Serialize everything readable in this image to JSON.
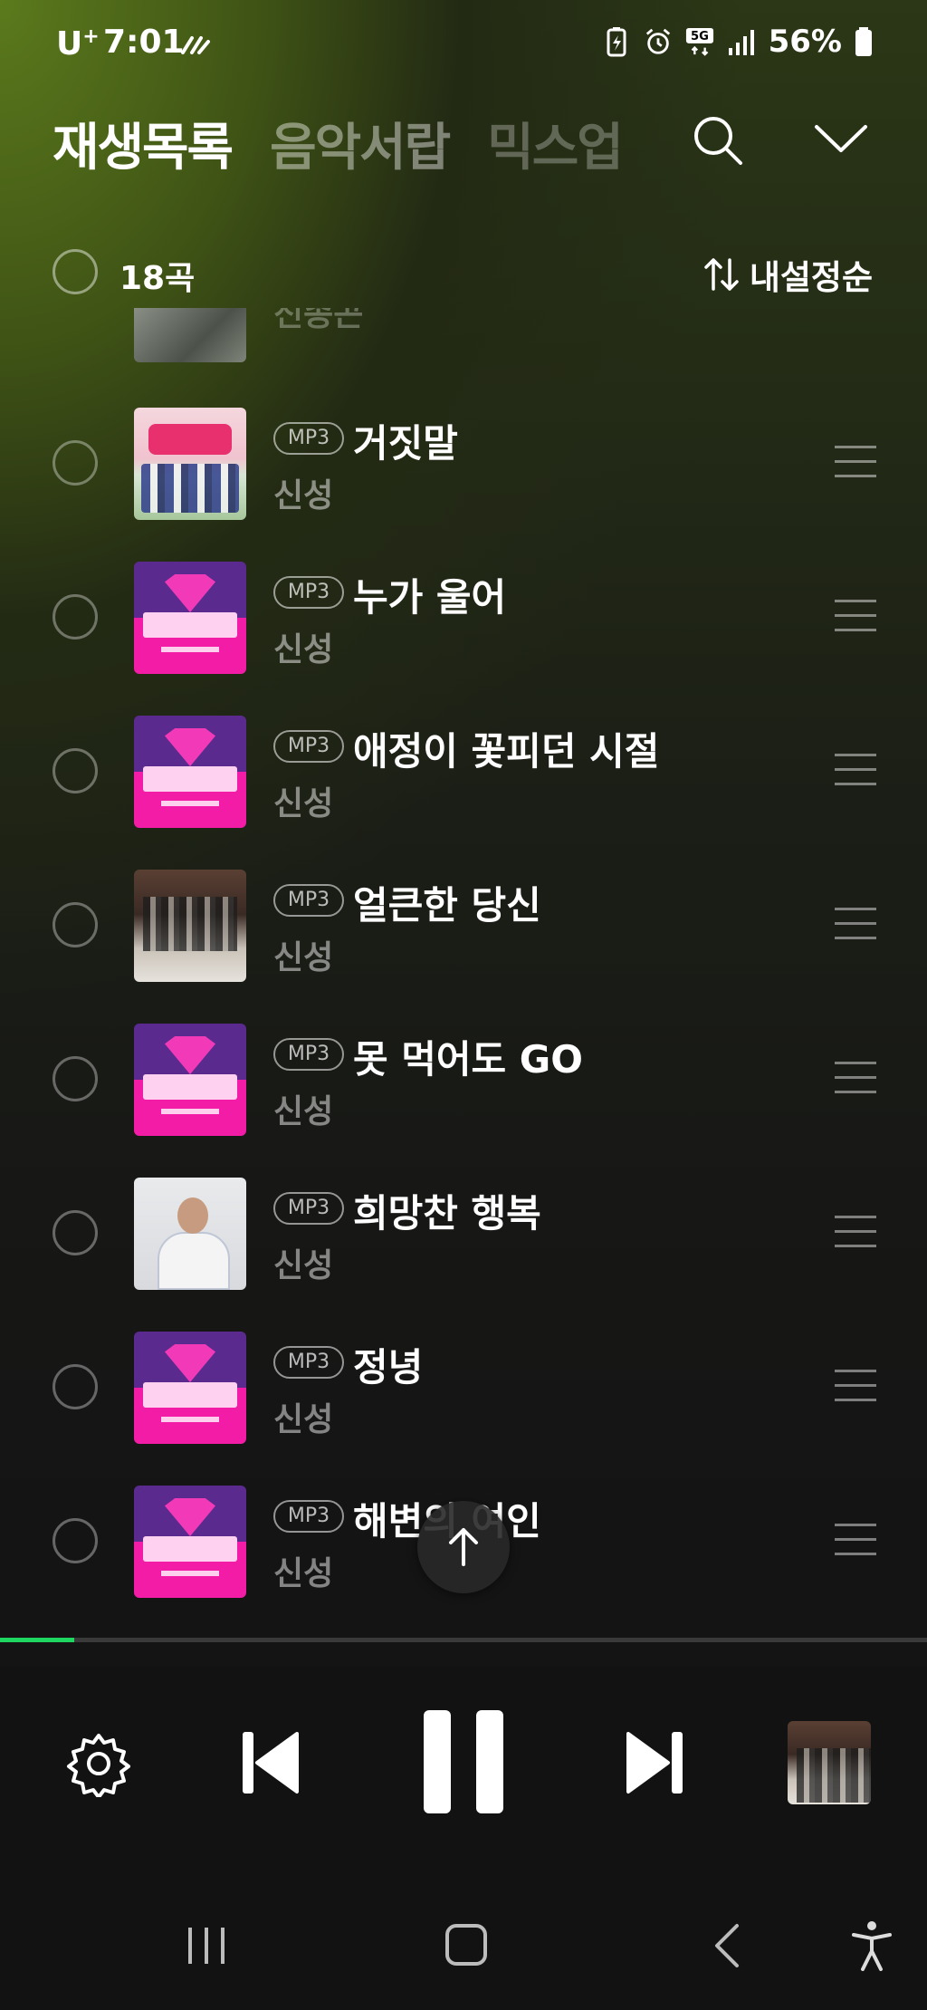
{
  "status_bar": {
    "carrier": "U",
    "carrier_sup": "+",
    "time": "7:01",
    "battery_percent": "56%",
    "icons": [
      "wifi-calling-icon",
      "battery-saver-icon",
      "alarm-icon",
      "5g-icon",
      "signal-icon",
      "battery-icon"
    ]
  },
  "tabs": [
    {
      "label": "재생목록",
      "active": true
    },
    {
      "label": "음악서랍",
      "active": false
    },
    {
      "label": "믹스업",
      "active": false
    }
  ],
  "header_icons": [
    "search-icon",
    "chevron-down-icon"
  ],
  "list_header": {
    "count": "18곡",
    "sort_label": "내설정순",
    "sort_icon": "sort-icon"
  },
  "partial_row": {
    "artist": "신종곤"
  },
  "tracks": [
    {
      "badge": "MP3",
      "title": "거짓말",
      "artist": "신성",
      "art": "show"
    },
    {
      "badge": "MP3",
      "title": "누가 울어",
      "artist": "신성",
      "art": "mr"
    },
    {
      "badge": "MP3",
      "title": "애정이 꽃피던 시절",
      "artist": "신성",
      "art": "mr"
    },
    {
      "badge": "MP3",
      "title": "얼큰한 당신",
      "artist": "신성",
      "art": "dance"
    },
    {
      "badge": "MP3",
      "title": "못 먹어도 GO",
      "artist": "신성",
      "art": "mr"
    },
    {
      "badge": "MP3",
      "title": "희망찬 행복",
      "artist": "신성",
      "art": "portrait"
    },
    {
      "badge": "MP3",
      "title": "정녕",
      "artist": "신성",
      "art": "mr"
    },
    {
      "badge": "MP3",
      "title": "해변의 여인",
      "artist": "신성",
      "art": "mr"
    }
  ],
  "playback": {
    "progress_fraction": 0.08,
    "state": "playing"
  },
  "player_icons": [
    "settings-icon",
    "previous-icon",
    "pause-icon",
    "next-icon"
  ],
  "colors": {
    "accent": "#1ed760",
    "background": "#121212",
    "glow": "#5b7a1c"
  },
  "nav_icons": [
    "recents-icon",
    "home-icon",
    "back-icon",
    "accessibility-icon"
  ]
}
